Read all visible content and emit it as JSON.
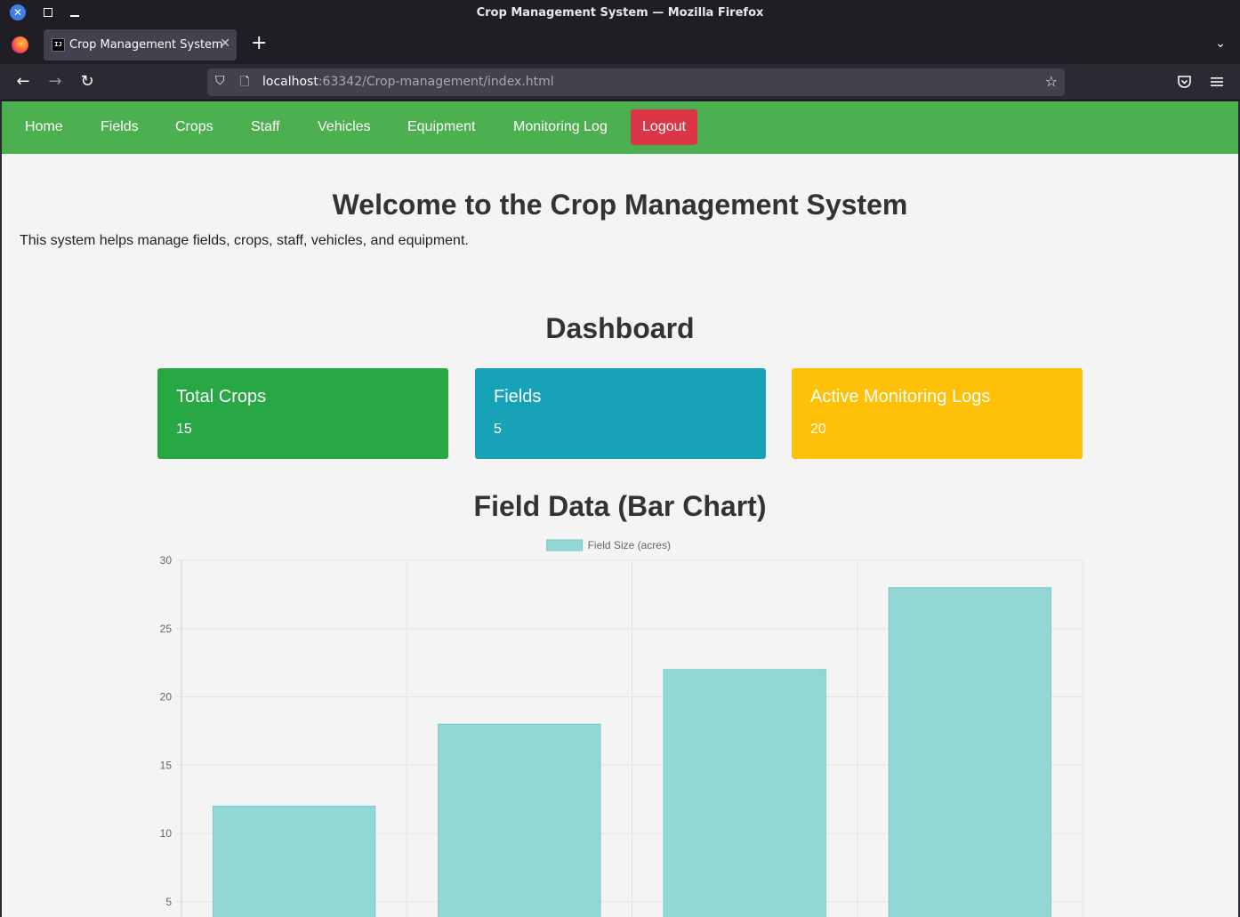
{
  "window": {
    "title": "Crop Management System — Mozilla Firefox"
  },
  "browser": {
    "tab_title": "Crop Management System",
    "url_host": "localhost",
    "url_path": ":63342/Crop-management/index.html"
  },
  "nav": {
    "links": [
      "Home",
      "Fields",
      "Crops",
      "Staff",
      "Vehicles",
      "Equipment",
      "Monitoring Log"
    ],
    "logout_label": "Logout"
  },
  "page": {
    "welcome_title": "Welcome to the Crop Management System",
    "intro": "This system helps manage fields, crops, staff, vehicles, and equipment.",
    "dashboard_title": "Dashboard",
    "chart_title": "Field Data (Bar Chart)"
  },
  "cards": [
    {
      "title": "Total Crops",
      "value": "15",
      "color": "#28a745"
    },
    {
      "title": "Fields",
      "value": "5",
      "color": "#17a2b8"
    },
    {
      "title": "Active Monitoring Logs",
      "value": "20",
      "color": "#ffc107"
    }
  ],
  "chart_data": {
    "type": "bar",
    "title": "",
    "xlabel": "",
    "ylabel": "",
    "series": [
      {
        "name": "Field Size (acres)",
        "values": [
          12,
          18,
          22,
          28
        ]
      }
    ],
    "ylim": [
      0,
      30
    ],
    "y_ticks": [
      5,
      10,
      15,
      20,
      25,
      30
    ],
    "grid": true,
    "legend": "top-center",
    "bar_fill": "#92d6d6",
    "bar_stroke": "#76c9c9"
  }
}
